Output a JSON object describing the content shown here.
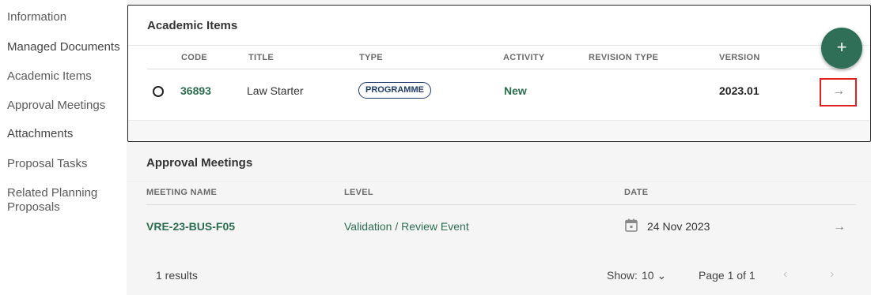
{
  "sidebar": {
    "items": [
      {
        "label": "Information"
      },
      {
        "label": "Managed Documents"
      },
      {
        "label": "Academic Items"
      },
      {
        "label": "Approval Meetings"
      },
      {
        "label": "Attachments"
      },
      {
        "label": "Proposal Tasks"
      },
      {
        "label": "Related Planning Proposals"
      }
    ]
  },
  "academic_items": {
    "title": "Academic Items",
    "columns": {
      "code": "CODE",
      "title": "TITLE",
      "type": "TYPE",
      "activity": "ACTIVITY",
      "revision_type": "REVISION TYPE",
      "version": "VERSION"
    },
    "rows": [
      {
        "code": "36893",
        "title": "Law Starter",
        "type": "PROGRAMME",
        "activity": "New",
        "revision_type": "",
        "version": "2023.01"
      }
    ],
    "add_button": "+",
    "open_arrow": "→"
  },
  "approval_meetings": {
    "title": "Approval Meetings",
    "columns": {
      "meeting_name": "MEETING NAME",
      "level": "LEVEL",
      "date": "DATE"
    },
    "rows": [
      {
        "meeting_name": "VRE-23-BUS-F05",
        "level": "Validation / Review Event",
        "date": "24 Nov 2023"
      }
    ],
    "open_arrow": "→",
    "footer": {
      "results": "1 results",
      "show_label": "Show:",
      "show_value": "10 ⌄",
      "page_info": "Page 1 of 1",
      "prev": "‹",
      "next": "›"
    }
  },
  "colors": {
    "accent_green": "#2b6e4e",
    "fab_green": "#2f6f57",
    "badge_navy": "#1e3a6e",
    "highlight_red": "#e02020"
  }
}
